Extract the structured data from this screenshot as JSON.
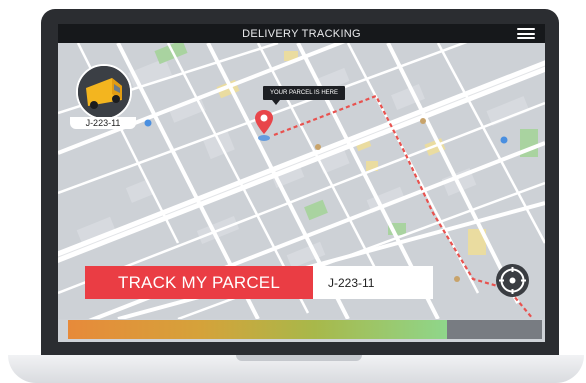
{
  "app": {
    "title": "DELIVERY TRACKING"
  },
  "courier": {
    "vehicle_id": "J-223-11"
  },
  "map": {
    "pin_tooltip": "YOUR PARCEL IS HERE"
  },
  "tracking": {
    "button_label": "TRACK MY PARCEL",
    "input_value": "J-223-11"
  },
  "progress": {
    "fraction": 0.8
  },
  "colors": {
    "accent": "#ea3d44",
    "route": "#e8524f",
    "titlebar": "#16181b"
  },
  "icons": {
    "menu": "hamburger-menu-icon",
    "locate": "crosshair-locate-icon",
    "pin": "location-pin-icon",
    "vehicle": "delivery-truck-icon"
  }
}
